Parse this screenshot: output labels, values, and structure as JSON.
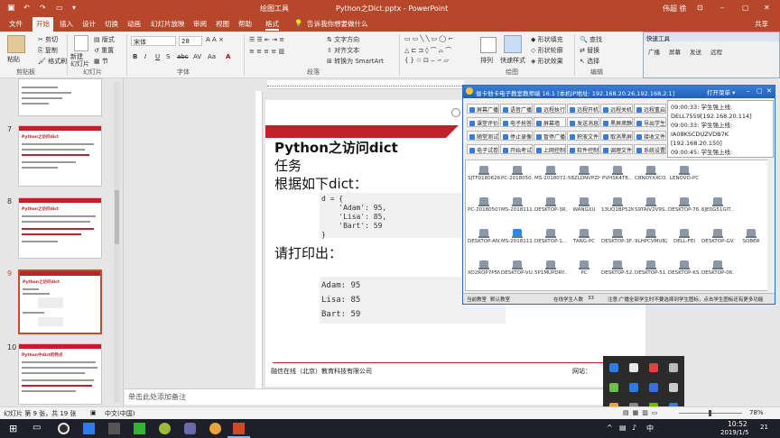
{
  "titlebar": {
    "drawing_tools": "绘图工具",
    "doc_title": "Python之Dict.pptx - PowerPoint",
    "user": "伟超 徐"
  },
  "tabs": [
    "文件",
    "开始",
    "插入",
    "设计",
    "切换",
    "动画",
    "幻灯片放映",
    "审阅",
    "视图",
    "帮助",
    "格式"
  ],
  "tell_me": "告诉我你想要做什么",
  "share": "共享",
  "ribbon": {
    "paste": "粘贴",
    "cut": "剪切",
    "copy": "复制",
    "format_painter": "格式刷",
    "clipboard": "剪贴板",
    "new_slide": "新建\n幻灯片",
    "layout": "版式",
    "reset": "重置",
    "section": "节",
    "slides_group": "幻灯片",
    "font_name": "宋体",
    "font_size": "28",
    "font_group": "字体",
    "text_direction": "文字方向",
    "align_text": "对齐文本",
    "smartart": "转换为 SmartArt",
    "paragraph": "段落",
    "drawing": "绘图",
    "arrange": "排列",
    "quick_styles": "快速样式",
    "shape_fill": "形状填充",
    "shape_outline": "形状轮廓",
    "shape_effects": "形状效果",
    "find": "查找",
    "replace": "替换",
    "select": "选择",
    "editing": "编辑"
  },
  "quick_tools": {
    "title": "快速工具",
    "items": [
      "广播",
      "屏幕",
      "发送",
      "远程"
    ]
  },
  "thumbnails": [
    {
      "num": "7",
      "title": "Python之访问dict",
      "selected": false
    },
    {
      "num": "8",
      "title": "Python之访问dict",
      "selected": false
    },
    {
      "num": "9",
      "title": "Python之访问dict",
      "selected": true
    },
    {
      "num": "10",
      "title": "Python中dict的特点",
      "selected": false
    }
  ],
  "slide": {
    "title": "Python之访问dict",
    "sub1": "任务",
    "sub2": "根据如下dict：",
    "code": "d = {\n    'Adam': 95,\n    'Lisa': 85,\n    'Bart': 59\n}",
    "print_label": "请打印出：",
    "output": "Adam: 95\nLisa: 85\nBart: 59",
    "footer_company": "融信在线（北京）教育科技有限公司",
    "footer_site": "网站："
  },
  "notes": "单击此处添加备注",
  "status": {
    "slide_info": "幻灯片 第 9 张，共 19 张",
    "language": "中文(中国)",
    "zoom": "78%"
  },
  "classroom": {
    "title": "伽卡他卡电子教室教师端 16.1 [本机IP地址: 192.168.20.26,192.168.2.1]",
    "menu": "打开菜单",
    "buttons": [
      "屏幕广播",
      "语音广播",
      "远程执行",
      "远程开机",
      "远程关机",
      "远程重启",
      "课堂评价",
      "电子抢答",
      "屏幕墙",
      "发送消息",
      "黑屏肃静",
      "导出学生记录",
      "随堂测试",
      "停止录像",
      "暂停广播",
      "积液文件",
      "取消黑屏",
      "接收文件记录",
      "电子试卷",
      "开始考试",
      "上网控制",
      "软件控制",
      "调理文件",
      "系统设置"
    ],
    "log": [
      "09:00:33: 学生强上线:",
      "DELL7559[192.168.20.114]",
      "09:00:33: 学生强上线:",
      "IA08KSCDUZVDB7K",
      "[192.168.20.150]",
      "09:00:45: 学生强上线:"
    ],
    "pcs": [
      [
        "SJTF0180626...",
        "PC-2018050...",
        "MS-2018072...",
        "58ZLDNVPZH...",
        "PVHSK4T8...",
        "CBNOYXXCO...",
        "LENOVO-PC"
      ],
      [
        "PC-20180507...",
        "MS-2018111...",
        "DESKTOP-3R...",
        "WANGXU",
        "13UQ1BP52K...",
        "S9TAIV2V9S...",
        "DESKTOP-76...",
        "6JE0G51GIT..."
      ],
      [
        "DESKTOP-AN...",
        "MS-2018111...",
        "DESKTOP-1...",
        "TANG-PC",
        "DESKTOP-3F...",
        "9LHPCVMUB2...",
        "DELL-FEI",
        "DESKTOP-GV...",
        "SOBER"
      ],
      [
        "XO2RQP7P5N...",
        "DESKTOP-VU...",
        "5P1MUPDRY...",
        "PC",
        "DESKTOP-52...",
        "DESKTOP-51...",
        "DESKTOP-KS...",
        "DESKTOP-06..."
      ]
    ],
    "status_left": "当前教室",
    "status_class": "默认教室",
    "status_count_label": "在线学生人数",
    "status_count": "33",
    "status_note": "注意:广播全部学生时不要选择到学生图标，点击学生图标还有更多功能"
  },
  "taskbar": {
    "time": "10:52",
    "date": "2019/1/5",
    "lang": "中",
    "notif": "21"
  }
}
